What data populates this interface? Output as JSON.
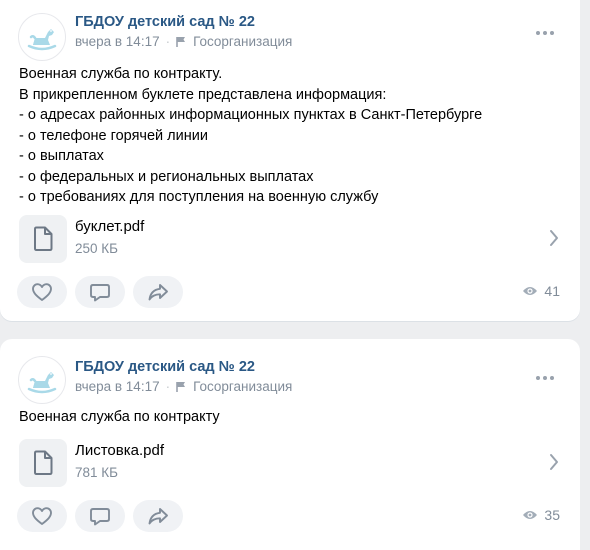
{
  "posts": [
    {
      "author": "ГБДОУ детский сад № 22",
      "time": "вчера в 14:17",
      "badge": "Госорганизация",
      "text_lines": [
        "Военная служба по контракту.",
        "В прикрепленном буклете представлена информация:",
        "- о адресах районных информационных пунктах в Санкт-Петербурге",
        "- о телефоне горячей линии",
        "- о выплатах",
        "- о федеральных и региональных выплатах",
        "- о требованиях для поступления на военную службу"
      ],
      "attachment": {
        "name": "буклет.pdf",
        "size": "250 КБ"
      },
      "views": "41"
    },
    {
      "author": "ГБДОУ детский сад № 22",
      "time": "вчера в 14:17",
      "badge": "Госорганизация",
      "text_lines": [
        "Военная служба по контракту"
      ],
      "attachment": {
        "name": "Листовка.pdf",
        "size": "781 КБ"
      },
      "views": "35"
    }
  ],
  "icons": {
    "avatar": "rocking-horse-icon",
    "badge": "flag-icon",
    "more": "more-dots-icon",
    "document": "document-icon",
    "open": "chevron-right-icon",
    "like": "heart-icon",
    "comment": "comment-icon",
    "share": "share-icon",
    "views": "eye-icon"
  },
  "colors": {
    "author": "#2a5885",
    "secondary_text": "#818c99",
    "icon": "#99a2ad",
    "button_bg": "#f0f2f5",
    "avatar_horse": "#a9d9e8"
  }
}
